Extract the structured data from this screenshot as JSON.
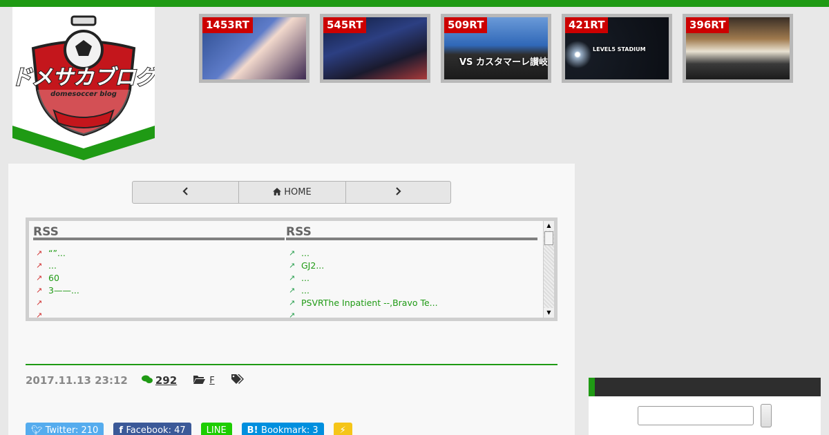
{
  "logo": {
    "text": "ドメサカブログ",
    "subtext": "domesoccer blog"
  },
  "thumbnails": [
    {
      "rt": "1453RT",
      "caption": ""
    },
    {
      "rt": "545RT",
      "caption": ""
    },
    {
      "rt": "509RT",
      "caption": "VS カスタマーレ讃岐"
    },
    {
      "rt": "421RT",
      "caption": "LEVEL5 STADIUM"
    },
    {
      "rt": "396RT",
      "caption": ""
    }
  ],
  "nav": {
    "home_label": "HOME"
  },
  "rss": {
    "left": {
      "heading": "RSS",
      "items": [
        "“”...",
        "...",
        "60",
        "3——...",
        "",
        ""
      ]
    },
    "right": {
      "heading": "RSS",
      "items": [
        "...",
        "GJ2...",
        "...",
        "...",
        "PSVRThe Inpatient --,Bravo Te...",
        ""
      ]
    }
  },
  "post_meta": {
    "date": "2017.11.13 23:12",
    "comments": "292",
    "category": "F"
  },
  "share": {
    "twitter": "Twitter: 210",
    "facebook": "Facebook: 47",
    "line": "LINE",
    "hatena": "Bookmark: 3"
  },
  "sidebar": {
    "search_value": ""
  }
}
